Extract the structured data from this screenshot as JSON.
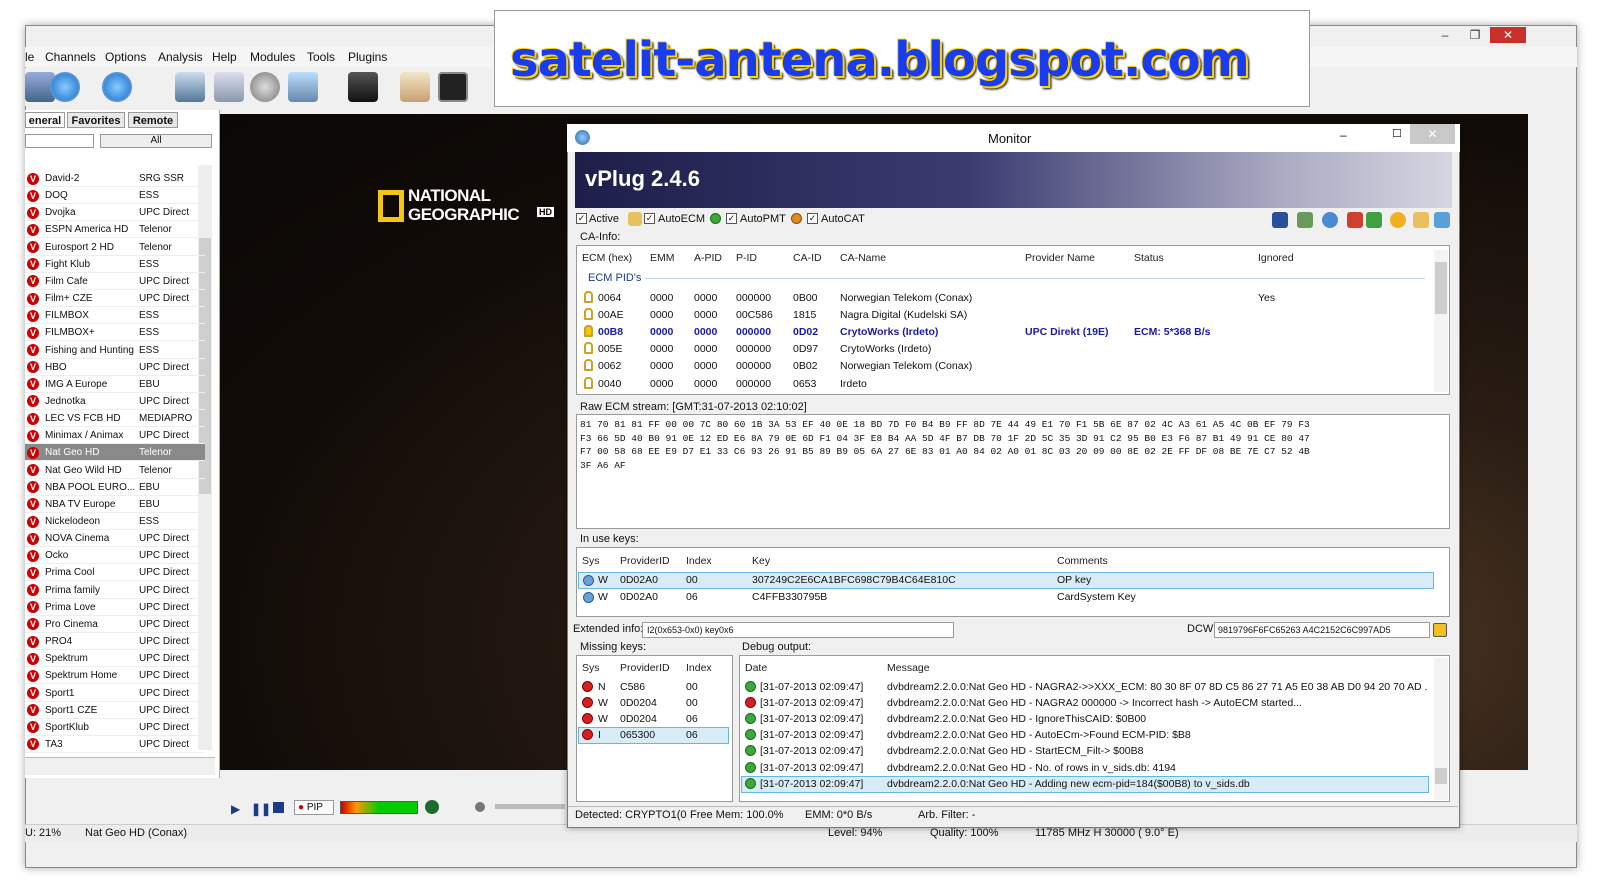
{
  "menu": {
    "items": [
      "le",
      "Channels",
      "Options",
      "Analysis",
      "Help",
      "Modules",
      "Tools",
      "Plugins"
    ]
  },
  "left_tabs": [
    "eneral",
    "Favorites",
    "Remote"
  ],
  "filter": {
    "value": "All"
  },
  "channels": [
    {
      "name": "David-2",
      "provider": "SRG SSR"
    },
    {
      "name": "DOQ",
      "provider": "ESS"
    },
    {
      "name": "Dvojka",
      "provider": "UPC Direct"
    },
    {
      "name": "ESPN America HD",
      "provider": "Telenor"
    },
    {
      "name": "Eurosport 2 HD",
      "provider": "Telenor"
    },
    {
      "name": "Fight Klub",
      "provider": "ESS"
    },
    {
      "name": "Film Cafe",
      "provider": "UPC Direct"
    },
    {
      "name": "Film+ CZE",
      "provider": "UPC Direct"
    },
    {
      "name": "FILMBOX",
      "provider": "ESS"
    },
    {
      "name": "FILMBOX+",
      "provider": "ESS"
    },
    {
      "name": "Fishing and Hunting",
      "provider": "ESS"
    },
    {
      "name": "HBO",
      "provider": "UPC Direct"
    },
    {
      "name": "IMG A Europe",
      "provider": "EBU"
    },
    {
      "name": "Jednotka",
      "provider": "UPC Direct"
    },
    {
      "name": "LEC VS FCB HD",
      "provider": "MEDIAPRO"
    },
    {
      "name": "Minimax / Animax",
      "provider": "UPC Direct"
    },
    {
      "name": "Nat Geo HD",
      "provider": "Telenor"
    },
    {
      "name": "Nat Geo Wild HD",
      "provider": "Telenor"
    },
    {
      "name": "NBA POOL EURO...",
      "provider": "EBU"
    },
    {
      "name": "NBA TV Europe",
      "provider": "EBU"
    },
    {
      "name": "Nickelodeon",
      "provider": "ESS"
    },
    {
      "name": "NOVA Cinema",
      "provider": "UPC Direct"
    },
    {
      "name": "Ocko",
      "provider": "UPC Direct"
    },
    {
      "name": "Prima Cool",
      "provider": "UPC Direct"
    },
    {
      "name": "Prima family",
      "provider": "UPC Direct"
    },
    {
      "name": "Prima Love",
      "provider": "UPC Direct"
    },
    {
      "name": "Pro Cinema",
      "provider": "UPC Direct"
    },
    {
      "name": "PRO4",
      "provider": "UPC Direct"
    },
    {
      "name": "Spektrum",
      "provider": "UPC Direct"
    },
    {
      "name": "Spektrum Home",
      "provider": "UPC Direct"
    },
    {
      "name": "Sport1",
      "provider": "UPC Direct"
    },
    {
      "name": "Sport1 CZE",
      "provider": "UPC Direct"
    },
    {
      "name": "SportKlub",
      "provider": "UPC Direct"
    },
    {
      "name": "TA3",
      "provider": "UPC Direct"
    }
  ],
  "selected_channel": "Nat Geo HD",
  "video": {
    "logo_line1": "NATIONAL",
    "logo_line2": "GEOGRAPHIC",
    "logo_hd": "HD"
  },
  "banner": {
    "text": "satelit-antena.blogspot.com"
  },
  "controls": {
    "pip_label": "PIP"
  },
  "status": {
    "cpu": "U: 21%",
    "channel": "Nat Geo HD (Conax)",
    "level": "Level: 94%",
    "quality": "Quality: 100%",
    "freq": "11785 MHz  H  30000  ( 9.0° E)"
  },
  "monitor": {
    "title": "Monitor",
    "header": "vPlug 2.4.6",
    "options": [
      "Active",
      "AutoECM",
      "AutoPMT",
      "AutoCAT"
    ],
    "ca_info_label": "CA-Info:",
    "ca_columns": [
      "ECM (hex)",
      "EMM",
      "A-PID",
      "P-ID",
      "CA-ID",
      "CA-Name",
      "Provider Name",
      "Status",
      "Ignored"
    ],
    "ecm_group": "ECM PID's",
    "ca_rows": [
      {
        "ecm": "0064",
        "emm": "0000",
        "apid": "0000",
        "pid": "000000",
        "caid": "0B00",
        "caname": "Norwegian Telekom (Conax)",
        "provider": "",
        "status": "",
        "ignored": "Yes"
      },
      {
        "ecm": "00AE",
        "emm": "0000",
        "apid": "0000",
        "pid": "00C586",
        "caid": "1815",
        "caname": "Nagra Digital (Kudelski SA)",
        "provider": "",
        "status": "",
        "ignored": ""
      },
      {
        "ecm": "00B8",
        "emm": "0000",
        "apid": "0000",
        "pid": "000000",
        "caid": "0D02",
        "caname": "CrytoWorks (Irdeto)",
        "provider": "UPC Direkt (19E)",
        "status": "ECM: 5*368 B/s",
        "ignored": ""
      },
      {
        "ecm": "005E",
        "emm": "0000",
        "apid": "0000",
        "pid": "000000",
        "caid": "0D97",
        "caname": "CrytoWorks (Irdeto)",
        "provider": "",
        "status": "",
        "ignored": ""
      },
      {
        "ecm": "0062",
        "emm": "0000",
        "apid": "0000",
        "pid": "000000",
        "caid": "0B02",
        "caname": "Norwegian Telekom (Conax)",
        "provider": "",
        "status": "",
        "ignored": ""
      },
      {
        "ecm": "0040",
        "emm": "0000",
        "apid": "0000",
        "pid": "000000",
        "caid": "0653",
        "caname": "Irdeto",
        "provider": "",
        "status": "",
        "ignored": ""
      }
    ],
    "raw_label": "Raw ECM stream: [GMT:31-07-2013 02:10:02]",
    "raw_lines": [
      "81 70 81 81 FF 00 00 7C 80 60 1B 3A 53 EF 40 0E 18 BD 7D F0 B4 B9 FF 8D 7E 44 49 E1 70 F1 5B 6E 87 02 4C A3 61 A5 4C 0B EF 79 F3",
      "F3 66 5D 40 B0 91 0E 12 ED E6 8A 79 0E 6D F1 04 3F E8 B4 AA 5D 4F B7 DB 70 1F 2D 5C 35 3D 91 C2 95 B0 E3 F6 87 B1 49 91 CE 80 47",
      "F7 00 58 68 EE E9 D7 E1 33 C6 93 26 91 B5 89 B9 05 6A 27 6E 83 01 A0 84 02 A0 01 8C 03 20 09 00 8E 02 2E FF DF 08 BE 7E C7 52 4B",
      "3F A6 AF"
    ],
    "inuse_label": "In use keys:",
    "key_columns": [
      "Sys",
      "ProviderID",
      "Index",
      "Key",
      "Comments"
    ],
    "key_rows": [
      {
        "sys": "W",
        "provider": "0D02A0",
        "index": "00",
        "key": "307249C2E6CA1BFC698C79B4C64E810C",
        "comment": "OP key"
      },
      {
        "sys": "W",
        "provider": "0D02A0",
        "index": "06",
        "key": "C4FFB330795B",
        "comment": "CardSystem Key"
      }
    ],
    "extended_label": "Extended info:",
    "extended_value": "I2(0x653-0x0) key0x6",
    "dcw_label": "DCW:",
    "dcw_value": "9819796F6FC65263 A4C2152C6C997AD5",
    "missing_label": "Missing keys:",
    "missing_columns": [
      "Sys",
      "ProviderID",
      "Index"
    ],
    "missing_rows": [
      {
        "sys": "N",
        "provider": "C586",
        "index": "00"
      },
      {
        "sys": "W",
        "provider": "0D0204",
        "index": "00"
      },
      {
        "sys": "W",
        "provider": "0D0204",
        "index": "06"
      },
      {
        "sys": "I",
        "provider": "065300",
        "index": "06"
      }
    ],
    "debug_label": "Debug output:",
    "debug_columns": [
      "Date",
      "Message"
    ],
    "debug_rows": [
      {
        "status": "ok",
        "date": "[31-07-2013 02:09:47]",
        "msg": "dvbdream2.2.0.0:Nat Geo HD - NAGRA2->>XXX_ECM: 80 30 8F 07 8D C5 86 27 71 A5 E0 38 AB D0 94 20 70 AD ..."
      },
      {
        "status": "err",
        "date": "[31-07-2013 02:09:47]",
        "msg": "dvbdream2.2.0.0:Nat Geo HD - NAGRA2 000000 -> Incorrect hash -> AutoECM started..."
      },
      {
        "status": "ok",
        "date": "[31-07-2013 02:09:47]",
        "msg": "dvbdream2.2.0.0:Nat Geo HD - IgnoreThisCAID: $0B00"
      },
      {
        "status": "ok",
        "date": "[31-07-2013 02:09:47]",
        "msg": "dvbdream2.2.0.0:Nat Geo HD - AutoECm->Found ECM-PID: $B8"
      },
      {
        "status": "ok",
        "date": "[31-07-2013 02:09:47]",
        "msg": "dvbdream2.2.0.0:Nat Geo HD - StartECM_Filt-> $00B8"
      },
      {
        "status": "ok",
        "date": "[31-07-2013 02:09:47]",
        "msg": "dvbdream2.2.0.0:Nat Geo HD - No. of rows in v_sids.db: 4194"
      },
      {
        "status": "ok",
        "date": "[31-07-2013 02:09:47]",
        "msg": "dvbdream2.2.0.0:Nat Geo HD - Adding new ecm-pid=184($00B8) to v_sids.db"
      }
    ],
    "status_detected": "Detected: CRYPTO1(0[",
    "status_mem": "Free Mem: 100.0%",
    "status_emm": "EMM: 0*0 B/s",
    "status_filter": "Arb. Filter: -"
  },
  "colors": {
    "accent": "#1a1aa8",
    "selected_row": "#d8ecf8",
    "banner_text": "#1a3cf0",
    "banner_shadow": "#ffd700",
    "ng_yellow": "#f3c613"
  }
}
